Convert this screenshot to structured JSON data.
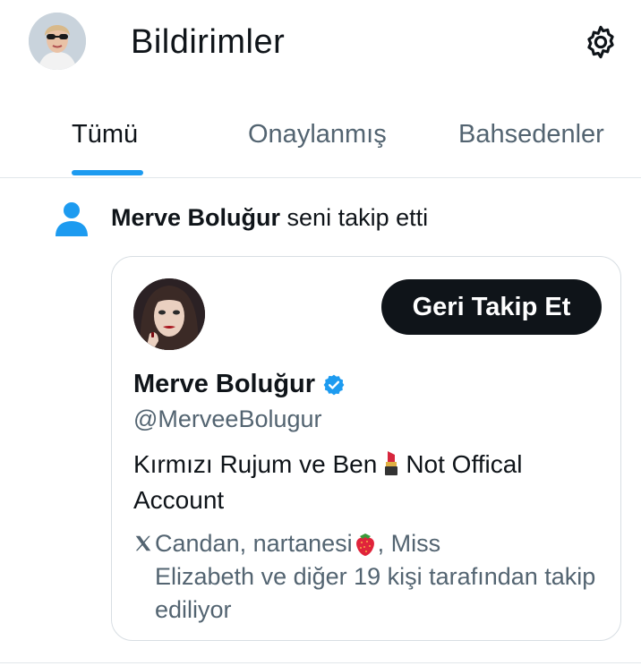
{
  "header": {
    "title": "Bildirimler",
    "settings_icon": "gear-icon",
    "avatar_icon": "profile-avatar"
  },
  "tabs": [
    {
      "label": "Tümü",
      "active": true
    },
    {
      "label": "Onaylanmış",
      "active": false
    },
    {
      "label": "Bahsedenler",
      "active": false
    }
  ],
  "notification": {
    "icon": "person-icon",
    "user": "Merve Boluğur",
    "action": " seni takip etti"
  },
  "card": {
    "follow_button": "Geri Takip Et",
    "name": "Merve Boluğur",
    "verified_icon": "verified-badge-icon",
    "handle": "@MerveeBolugur",
    "bio_part1": "Kırmızı Rujum ve Ben",
    "bio_emoji": "lipstick-emoji",
    "bio_part2": "Not Offical Account",
    "followers_part1": "Candan, nartanesi",
    "followers_emoji": "strawberry-emoji",
    "followers_part2": ", Miss",
    "followers_line2": "Elizabeth ve diğer 19 kişi tarafından takip ediliyor"
  },
  "colors": {
    "accent": "#1d9bf0",
    "text": "#0f1419",
    "muted": "#536471"
  }
}
